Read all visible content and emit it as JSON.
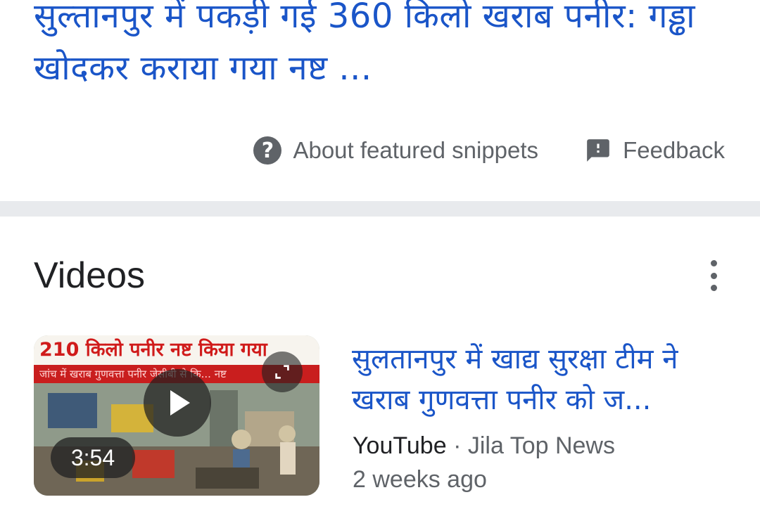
{
  "featured_snippet": {
    "title": "सुल्तानपुर में पकड़ी गई 360 किलो खराब पनीर: गड्ढा खोदकर कराया गया नष्ट ...",
    "about_label": "About featured snippets",
    "feedback_label": "Feedback",
    "about_icon": "help-circle-icon",
    "feedback_icon": "feedback-icon"
  },
  "videos": {
    "header": "Videos",
    "more_icon": "more-vert-icon",
    "items": [
      {
        "thumbnail_headline": "210 किलो पनीर नष्ट किया गया",
        "thumbnail_subline": "जांच में खराब गुणवत्ता पनीर जेसीबी से कि... नष्ट",
        "duration": "3:54",
        "title": "सुलतानपुर में खाद्य सुरक्षा टीम ने खराब गुणवत्ता पनीर को ज...",
        "source": "YouTube",
        "separator": "·",
        "channel": "Jila Top News",
        "age": "2 weeks ago"
      }
    ]
  },
  "colors": {
    "link": "#1a55c8",
    "secondary_text": "#5f6368",
    "divider": "#e8eaed"
  }
}
